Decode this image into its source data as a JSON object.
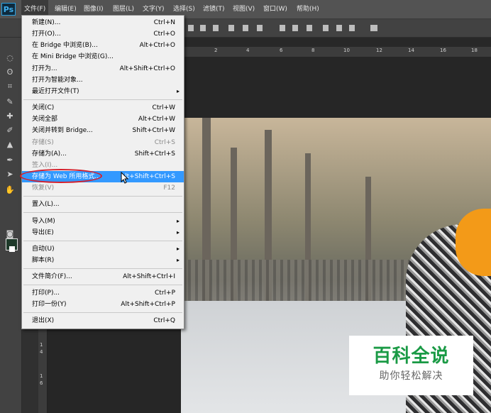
{
  "app": {
    "logo": "Ps"
  },
  "menubar": {
    "items": [
      "文件(F)",
      "编辑(E)",
      "图像(I)",
      "图层(L)",
      "文字(Y)",
      "选择(S)",
      "滤镜(T)",
      "视图(V)",
      "窗口(W)",
      "帮助(H)"
    ]
  },
  "ruler": {
    "top_ticks": [
      "2",
      "4",
      "6",
      "8",
      "10",
      "12",
      "14",
      "16",
      "18"
    ],
    "left_ticks": [
      "1",
      "4",
      "1",
      "6"
    ]
  },
  "file_menu": {
    "items": [
      {
        "label": "新建(N)...",
        "shortcut": "Ctrl+N"
      },
      {
        "label": "打开(O)...",
        "shortcut": "Ctrl+O"
      },
      {
        "label": "在 Bridge 中浏览(B)...",
        "shortcut": "Alt+Ctrl+O"
      },
      {
        "label": "在 Mini Bridge 中浏览(G)...",
        "shortcut": ""
      },
      {
        "label": "打开为...",
        "shortcut": "Alt+Shift+Ctrl+O"
      },
      {
        "label": "打开为智能对象...",
        "shortcut": ""
      },
      {
        "label": "最近打开文件(T)",
        "shortcut": ""
      },
      {
        "label": "关闭(C)",
        "shortcut": "Ctrl+W"
      },
      {
        "label": "关闭全部",
        "shortcut": "Alt+Ctrl+W"
      },
      {
        "label": "关闭并转到 Bridge...",
        "shortcut": "Shift+Ctrl+W"
      },
      {
        "label": "存储(S)",
        "shortcut": "Ctrl+S"
      },
      {
        "label": "存储为(A)...",
        "shortcut": "Shift+Ctrl+S"
      },
      {
        "label": "签入(I)...",
        "shortcut": ""
      },
      {
        "label": "存储为 Web 所用格式...",
        "shortcut": "Alt+Shift+Ctrl+S"
      },
      {
        "label": "恢复(V)",
        "shortcut": "F12"
      },
      {
        "label": "置入(L)...",
        "shortcut": ""
      },
      {
        "label": "导入(M)",
        "shortcut": ""
      },
      {
        "label": "导出(E)",
        "shortcut": ""
      },
      {
        "label": "自动(U)",
        "shortcut": ""
      },
      {
        "label": "脚本(R)",
        "shortcut": ""
      },
      {
        "label": "文件简介(F)...",
        "shortcut": "Alt+Shift+Ctrl+I"
      },
      {
        "label": "打印(P)...",
        "shortcut": "Ctrl+P"
      },
      {
        "label": "打印一份(Y)",
        "shortcut": "Alt+Shift+Ctrl+P"
      },
      {
        "label": "退出(X)",
        "shortcut": "Ctrl+Q"
      }
    ],
    "selected": "存储为 Web 所用格式...",
    "submenu_arrow": "▸"
  },
  "watermark": {
    "title": "百科全说",
    "subtitle": "助你轻松解决"
  },
  "colors": {
    "menu_highlight": "#3399ff",
    "annotation_oval": "#d4202c",
    "watermark_green": "#1a9a45",
    "foreground_swatch": "#1e3a2a"
  }
}
